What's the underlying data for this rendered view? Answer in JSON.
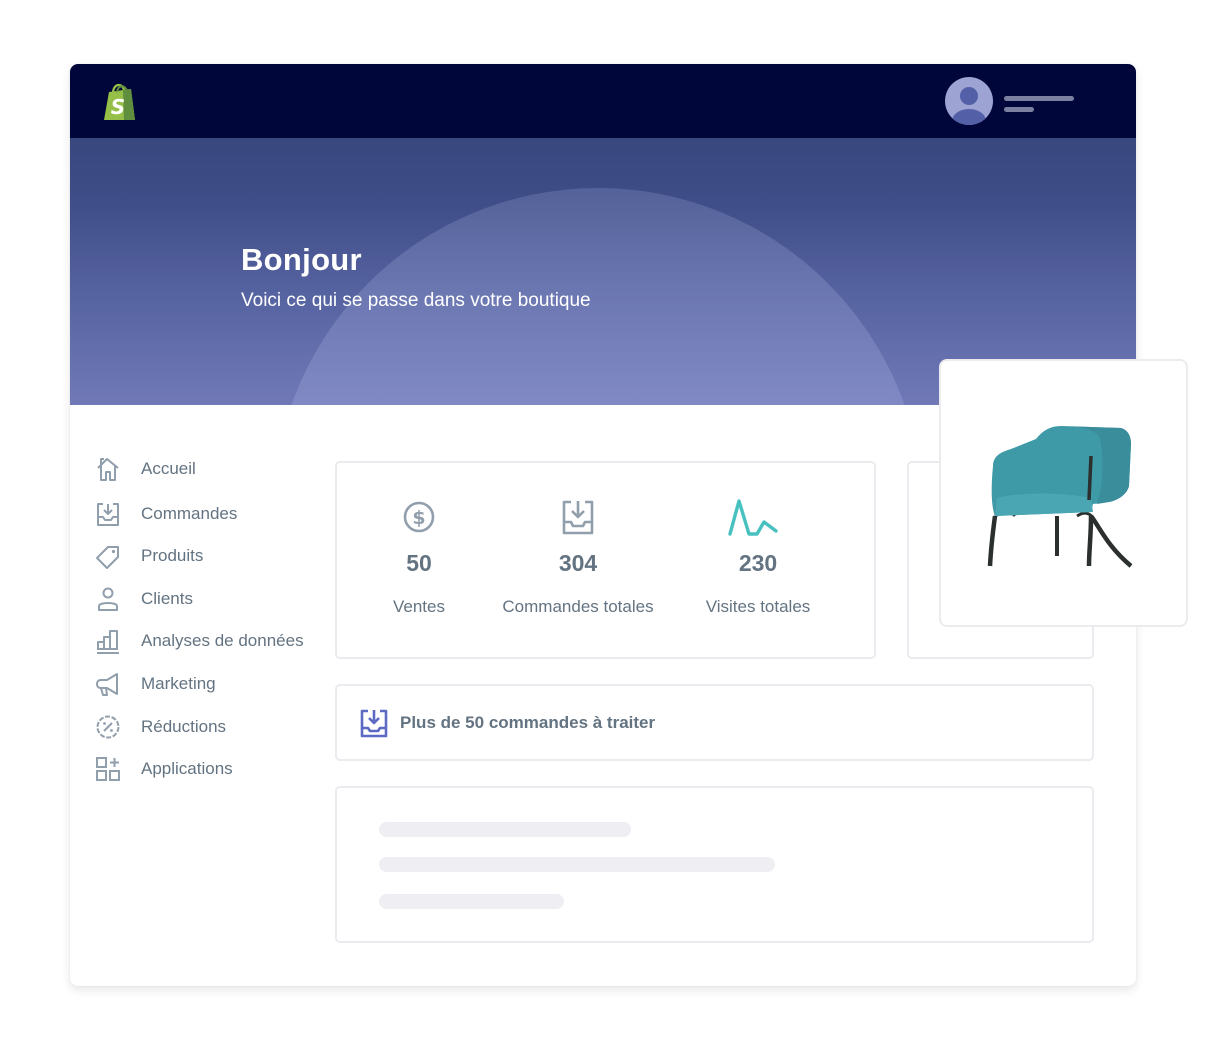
{
  "app": {
    "logo": "shopify-bag-logo",
    "user": {
      "avatar": "user-avatar-icon"
    }
  },
  "hero": {
    "title": "Bonjour",
    "subtitle": "Voici ce qui se passe dans votre boutique"
  },
  "sidebar": {
    "items": [
      {
        "label": "Accueil",
        "icon": "home-icon"
      },
      {
        "label": "Commandes",
        "icon": "inbox-download-icon"
      },
      {
        "label": "Produits",
        "icon": "tag-icon"
      },
      {
        "label": "Clients",
        "icon": "person-icon"
      },
      {
        "label": "Analyses de données",
        "icon": "bar-chart-icon"
      },
      {
        "label": "Marketing",
        "icon": "megaphone-icon"
      },
      {
        "label": "Réductions",
        "icon": "discount-icon"
      },
      {
        "label": "Applications",
        "icon": "apps-icon"
      }
    ]
  },
  "stats": [
    {
      "value": "50",
      "label": "Ventes",
      "icon": "dollar-circle-icon"
    },
    {
      "value": "304",
      "label": "Commandes totales",
      "icon": "inbox-download-icon"
    },
    {
      "value": "230",
      "label": "Visites totales",
      "icon": "sparkline-icon"
    }
  ],
  "alert": {
    "text": "Plus de 50 commandes à traiter",
    "icon": "inbox-download-icon"
  },
  "product": {
    "image": "teal-armchair"
  },
  "colors": {
    "topbar": "#000639",
    "hero_top": "#39477f",
    "hero_bottom": "#7179b7",
    "text_muted": "#637381",
    "icon_gray": "#919eab",
    "accent_teal": "#47c1bf",
    "accent_indigo": "#5c6ac4",
    "shopify_green": "#95bf47",
    "chair_teal": "#3f9aa8"
  }
}
